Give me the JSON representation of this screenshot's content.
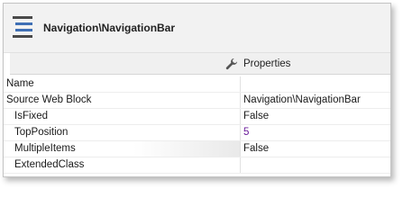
{
  "header": {
    "title": "Navigation\\NavigationBar",
    "icon": "hamburger-icon",
    "icon_color": "#3f6fb5"
  },
  "tab": {
    "label": "Properties",
    "icon": "wrench-icon"
  },
  "properties": [
    {
      "name": "Name",
      "value": "",
      "indent": false
    },
    {
      "name": "Source Web Block",
      "value": "Navigation\\NavigationBar",
      "indent": false
    },
    {
      "name": "IsFixed",
      "value": "False",
      "indent": true
    },
    {
      "name": "TopPosition",
      "value": "5",
      "indent": true,
      "value_color": "#6a1b9a"
    },
    {
      "name": "MultipleItems",
      "value": "False",
      "indent": true
    },
    {
      "name": "ExtendedClass",
      "value": "",
      "indent": true
    }
  ]
}
